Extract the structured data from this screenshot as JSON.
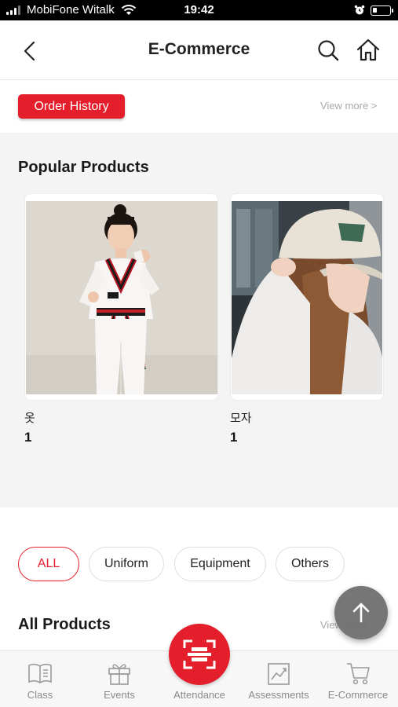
{
  "status_bar": {
    "carrier": "MobiFone Witalk",
    "time": "19:42"
  },
  "header": {
    "title": "E-Commerce"
  },
  "order_history": {
    "button_label": "Order History",
    "view_more": "View more >"
  },
  "popular": {
    "title": "Popular Products",
    "products": [
      {
        "name": "옷",
        "price": "1"
      },
      {
        "name": "모자",
        "price": "1"
      }
    ]
  },
  "filters": {
    "chips": [
      "ALL",
      "Uniform",
      "Equipment",
      "Others"
    ],
    "active": "ALL"
  },
  "all_products": {
    "title": "All Products",
    "view_more": "View more >"
  },
  "bottom_nav": {
    "items": [
      {
        "label": "Class",
        "icon": "book-icon"
      },
      {
        "label": "Events",
        "icon": "gift-icon"
      },
      {
        "label": "Attendance",
        "icon": "scan-icon"
      },
      {
        "label": "Assessments",
        "icon": "chart-icon"
      },
      {
        "label": "E-Commerce",
        "icon": "cart-icon"
      }
    ]
  },
  "colors": {
    "accent": "#e41e2b",
    "background_section": "#f4f4f4",
    "muted_text": "#8a8a8a"
  }
}
